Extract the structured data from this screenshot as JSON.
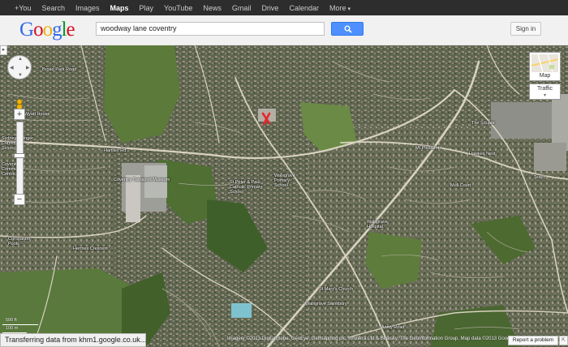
{
  "top_nav": {
    "items": [
      "+You",
      "Search",
      "Images",
      "Maps",
      "Play",
      "YouTube",
      "News",
      "Gmail",
      "Drive",
      "Calendar",
      "More"
    ],
    "active": "Maps"
  },
  "logo": {
    "text": "Google",
    "colors": [
      "#3369e8",
      "#d50f25",
      "#eeb211",
      "#3369e8",
      "#009925",
      "#d50f25"
    ]
  },
  "search": {
    "value": "woodway lane coventry",
    "button_icon": "search-icon",
    "button_color": "#4d90fe"
  },
  "signin": {
    "label": "Sign in"
  },
  "map": {
    "view": "satellite",
    "marker_icon": "red-x-marker-icon",
    "place_labels": [
      "Broad Park Road",
      "Wyatt House",
      "Hamley Rd",
      "Sydney Stringer Community School",
      "Coventry Community Centre",
      "Coventry Transport Museum",
      "St Peter & Paul Catholic Primary School",
      "Walsgrave Primary School",
      "Walsgrave Hospital",
      "Mull Court",
      "Mt Pleasant",
      "The Square",
      "Hawkes Nest",
      "Tesco",
      "Coronation Pools",
      "Hermes Crescent",
      "St Mary's Church",
      "Walsgrave Sainsbury",
      "Ansty Road"
    ],
    "map_type_label": "Map",
    "traffic_label": "Traffic",
    "scale": {
      "imperial": "500 ft",
      "metric": "100 m"
    },
    "copyright": "Imagery ©2013 DigitalGlobe, GeoEye, Getmapping plc, Infoterra Ltd & Bluesky, The GeoInformation Group, Map data ©2013 Google -",
    "report_problem": "Report a problem"
  },
  "status_bar": {
    "text": "Transferring data from khm1.google.co.uk..."
  },
  "panel_toggle_icon": "chevron-right-icon"
}
